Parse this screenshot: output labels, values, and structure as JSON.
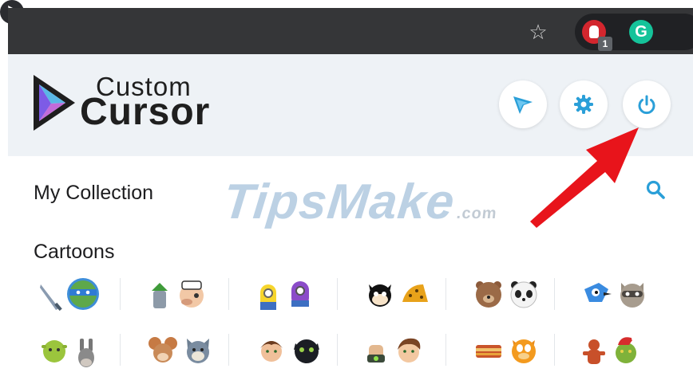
{
  "browser": {
    "extensions": [
      {
        "icon": "stop-hand-icon",
        "badge": "1",
        "color": "#d3262e"
      },
      {
        "icon": "grammarly-icon",
        "glyph": "G",
        "color": "#15c39a"
      },
      {
        "icon": "custom-cursor-icon",
        "color": "#2b2c30"
      }
    ]
  },
  "app": {
    "logo": {
      "line1": "Custom",
      "line2": "Cursor"
    },
    "header_buttons": [
      {
        "name": "cursor",
        "icon": "cursor-arrow-icon"
      },
      {
        "name": "settings",
        "icon": "gear-icon"
      },
      {
        "name": "power",
        "icon": "power-icon"
      }
    ],
    "accent_color": "#2a9fd8"
  },
  "collection": {
    "title": "My Collection",
    "search_icon": "search-icon",
    "category": "Cartoons"
  },
  "watermark": {
    "main": "TipsMake",
    "suffix": ".com"
  },
  "cursor_packs": [
    {
      "row": 1,
      "items": [
        "sword + ninja turtle",
        "popeye pair",
        "minions",
        "felix the cat",
        "we bare bears",
        "regular show"
      ]
    },
    {
      "row": 2,
      "items": [
        "shrek + donkey",
        "tom and jerry",
        "how to train your dragon",
        "ben 10",
        "garfield",
        "grinch"
      ]
    }
  ],
  "annotation": {
    "arrow_color": "#e8141b",
    "target": "power-button"
  }
}
